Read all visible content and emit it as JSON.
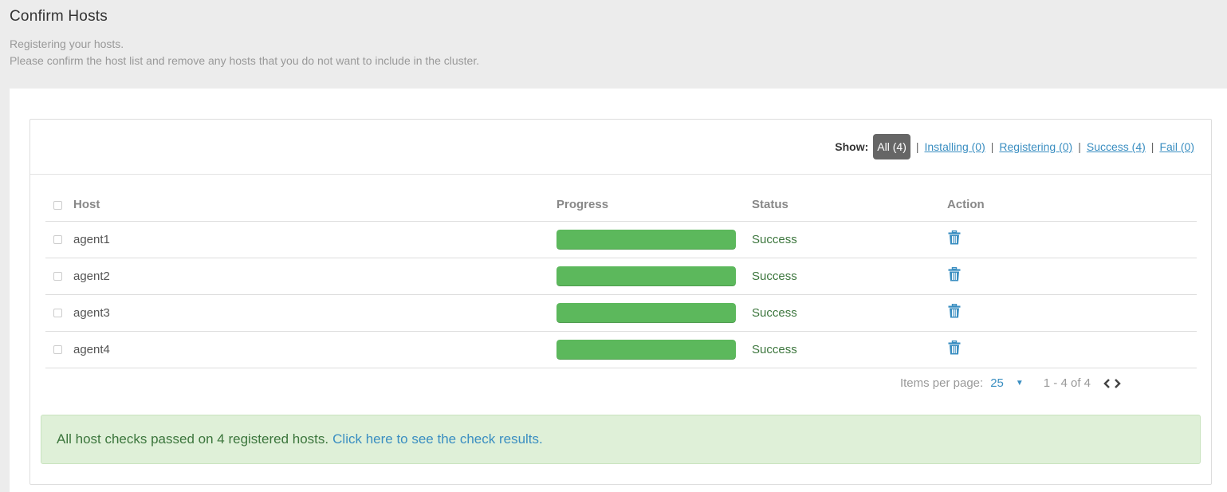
{
  "header": {
    "title": "Confirm Hosts",
    "subtitle_1": "Registering your hosts.",
    "subtitle_2": "Please confirm the host list and remove any hosts that you do not want to include in the cluster."
  },
  "filter": {
    "label": "Show:",
    "options": [
      {
        "label": "All (4)",
        "active": true
      },
      {
        "label": "Installing (0)",
        "active": false
      },
      {
        "label": "Registering (0)",
        "active": false
      },
      {
        "label": "Success (4)",
        "active": false
      },
      {
        "label": "Fail (0)",
        "active": false
      }
    ],
    "separator": "|"
  },
  "table": {
    "columns": [
      "Host",
      "Progress",
      "Status",
      "Action"
    ],
    "rows": [
      {
        "host": "agent1",
        "progress": 1.0,
        "status": "Success",
        "action_icon": "trash-icon"
      },
      {
        "host": "agent2",
        "progress": 1.0,
        "status": "Success",
        "action_icon": "trash-icon"
      },
      {
        "host": "agent3",
        "progress": 1.0,
        "status": "Success",
        "action_icon": "trash-icon"
      },
      {
        "host": "agent4",
        "progress": 1.0,
        "status": "Success",
        "action_icon": "trash-icon"
      }
    ]
  },
  "pagination": {
    "per_page_label": "Items per page:",
    "per_page_value": "25",
    "range": "1 - 4 of 4"
  },
  "alert": {
    "message": "All host checks passed on 4 registered hosts.",
    "link": "Click here to see the check results."
  },
  "colors": {
    "accent": "#3a8ec1",
    "success_bar": "#5cb85c",
    "success_text": "#3c763d",
    "alert_bg": "#dff0d8"
  }
}
